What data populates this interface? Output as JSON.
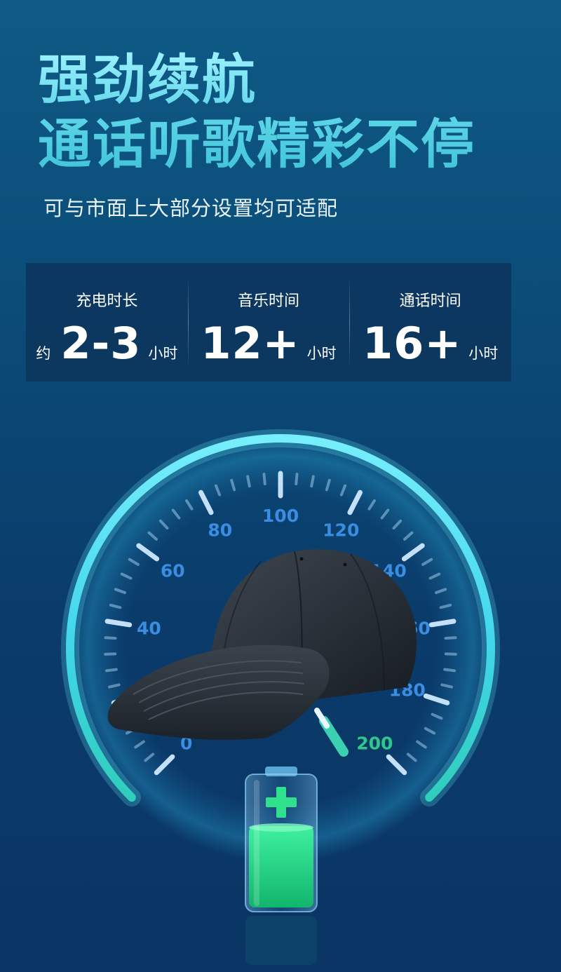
{
  "headline": {
    "line1": "强劲续航",
    "line2": "通话听歌精彩不停"
  },
  "subtitle": "可与市面上大部分设置均可适配",
  "stats": [
    {
      "label": "充电时长",
      "prefix": "约",
      "value": "2-3",
      "unit": "小时"
    },
    {
      "label": "音乐时间",
      "prefix": "",
      "value": "12+",
      "unit": "小时"
    },
    {
      "label": "通话时间",
      "prefix": "",
      "value": "16+",
      "unit": "小时"
    }
  ],
  "gauge": {
    "ticks": [
      "0",
      "20",
      "40",
      "60",
      "80",
      "100",
      "120",
      "140",
      "160",
      "180",
      "200"
    ],
    "highlight_tick": "200",
    "colors": {
      "tick": "#3a8de0",
      "highlight": "#2ec88a",
      "ring": "#35d4e8"
    }
  },
  "product": {
    "icon": "baseball-cap-icon"
  },
  "battery": {
    "icon": "battery-charging-icon",
    "color": "#2ee08e"
  }
}
